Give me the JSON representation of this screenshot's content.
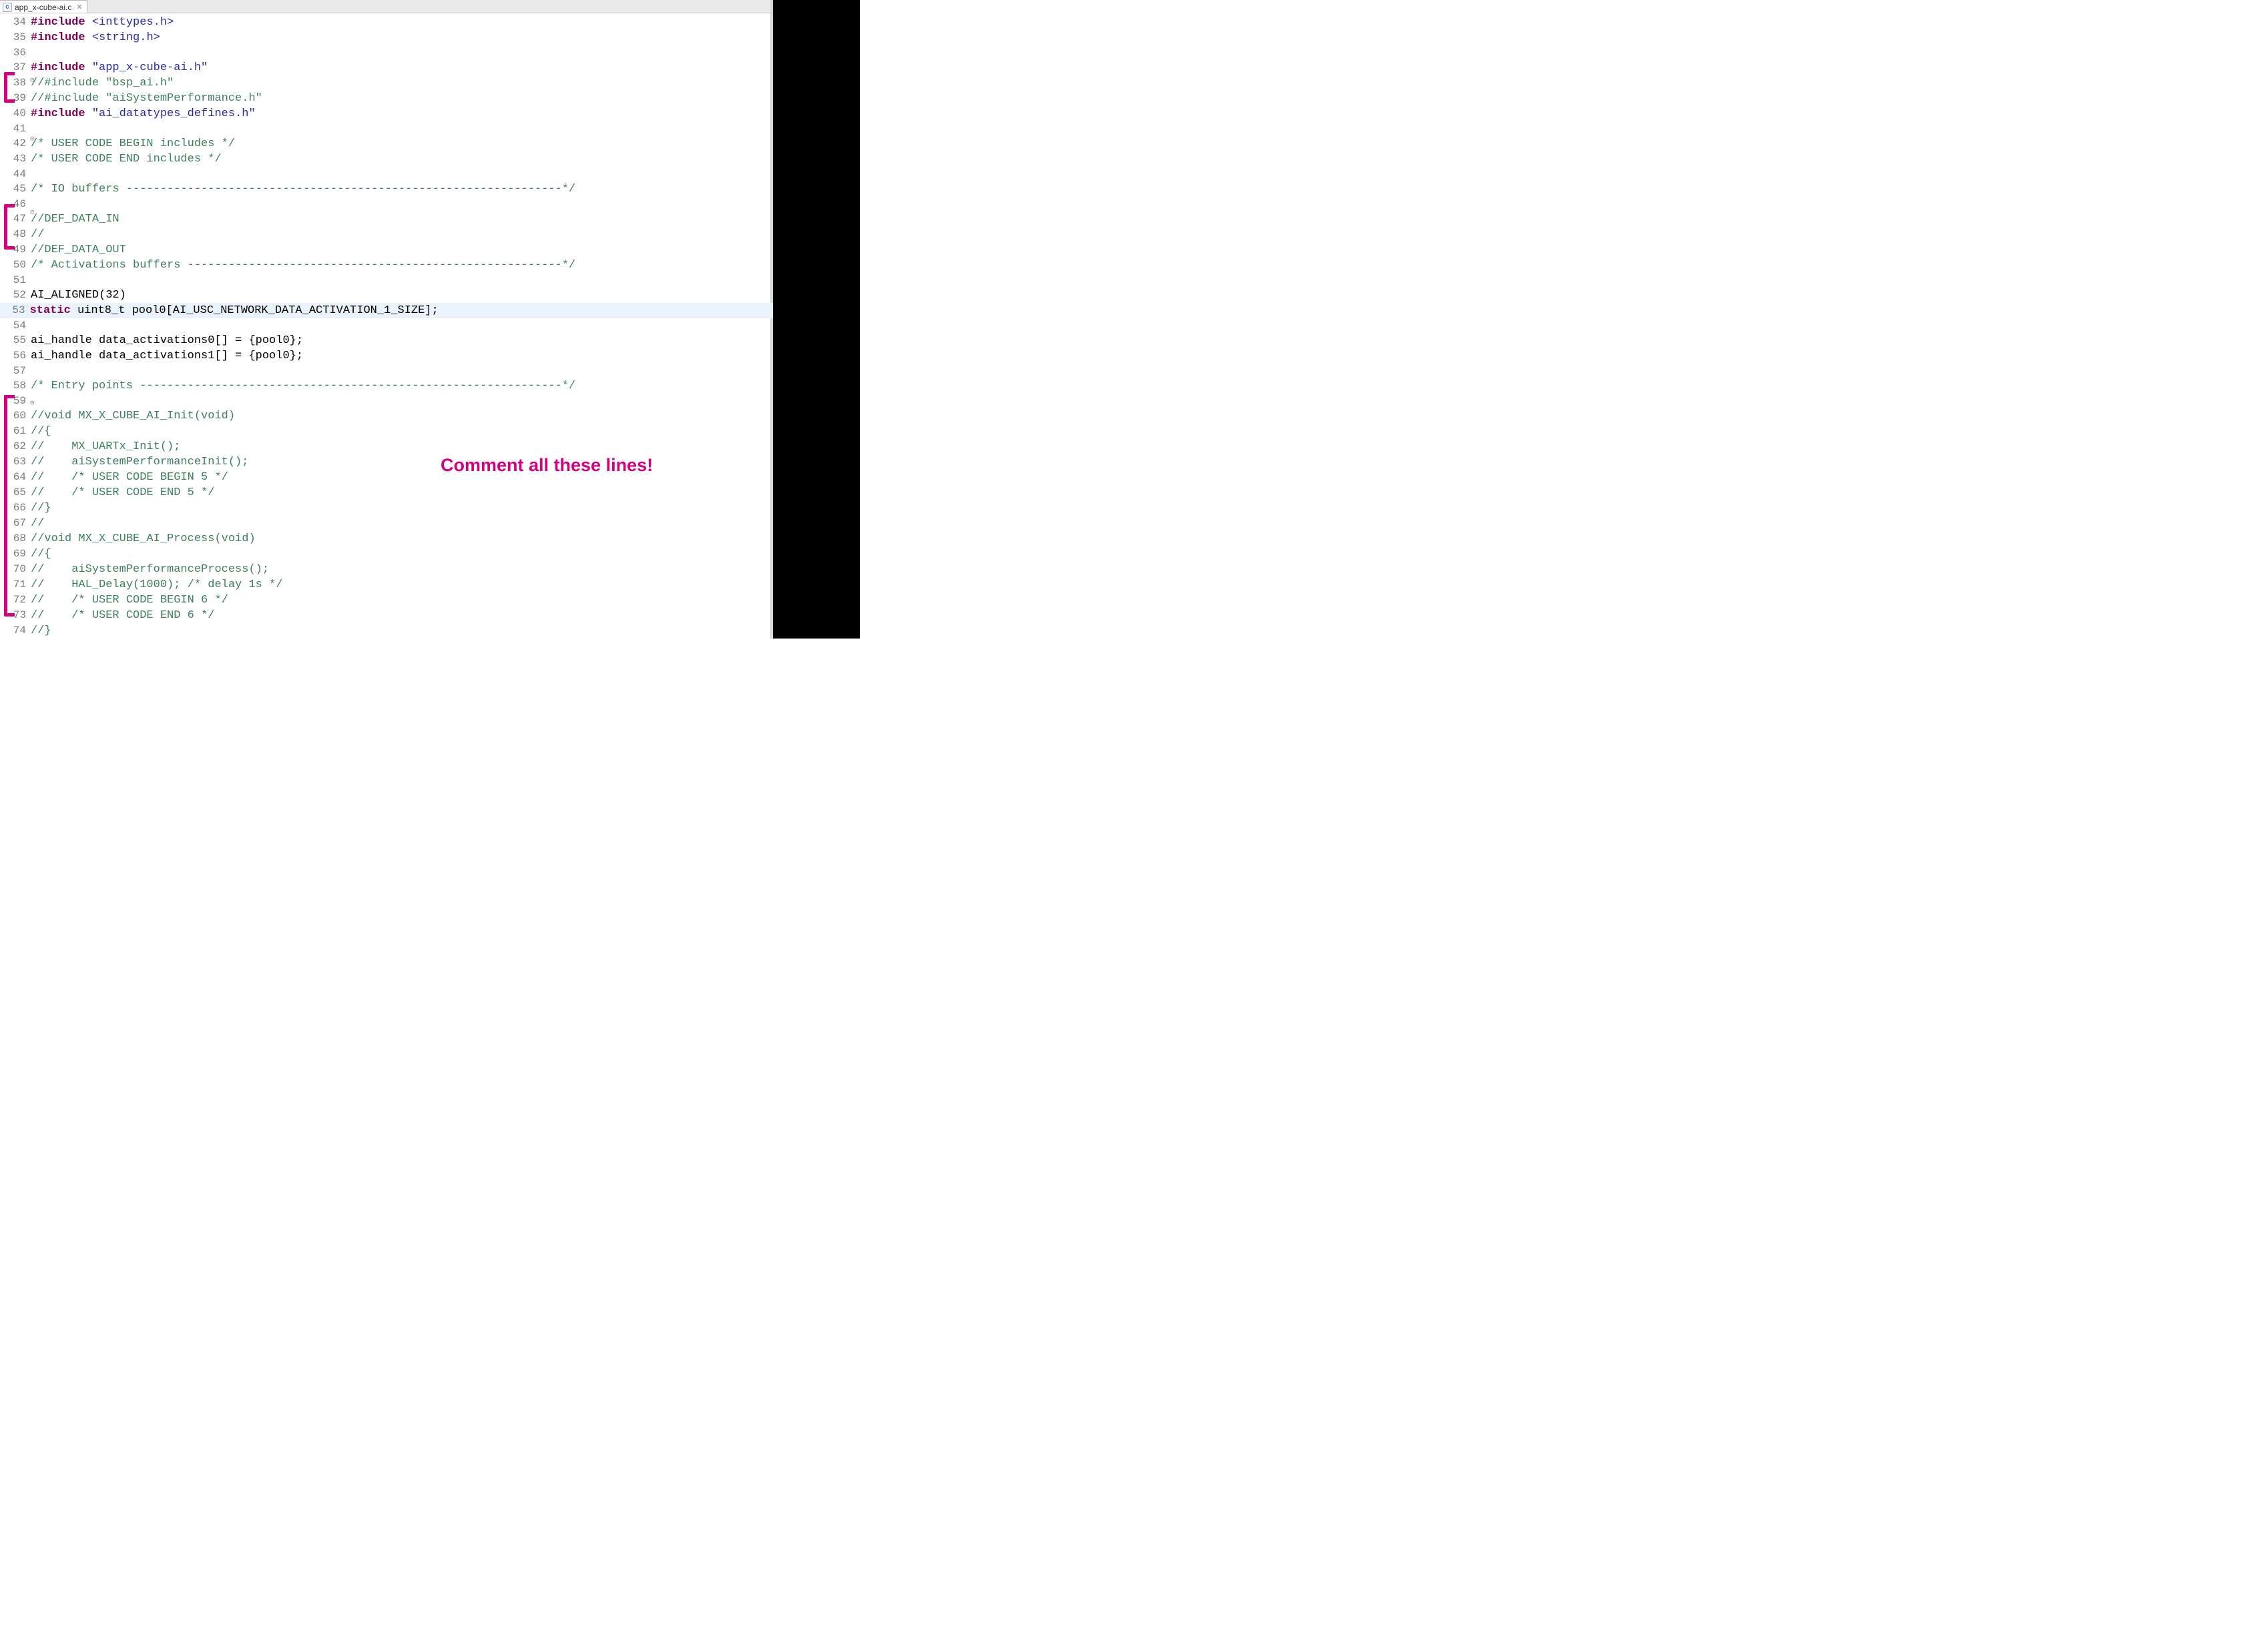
{
  "tab": {
    "icon_letter": "c",
    "filename": "app_x-cube-ai.c",
    "close_glyph": "✕"
  },
  "annotation": {
    "text": "Comment all these lines!"
  },
  "code_lines": [
    {
      "n": 34,
      "fold": "",
      "segs": [
        {
          "c": "pp",
          "t": "#include "
        },
        {
          "c": "inc",
          "t": "<inttypes.h>"
        }
      ]
    },
    {
      "n": 35,
      "fold": "",
      "segs": [
        {
          "c": "pp",
          "t": "#include "
        },
        {
          "c": "inc",
          "t": "<string.h>"
        }
      ]
    },
    {
      "n": 36,
      "fold": "",
      "segs": [
        {
          "c": "",
          "t": ""
        }
      ]
    },
    {
      "n": 37,
      "fold": "",
      "segs": [
        {
          "c": "pp",
          "t": "#include "
        },
        {
          "c": "str",
          "t": "\"app_x-cube-ai.h\""
        }
      ]
    },
    {
      "n": 38,
      "fold": "⊝",
      "segs": [
        {
          "c": "cmt",
          "t": "//#include \"bsp_ai.h\""
        }
      ]
    },
    {
      "n": 39,
      "fold": "",
      "segs": [
        {
          "c": "cmt",
          "t": "//#include \"aiSystemPerformance.h\""
        }
      ]
    },
    {
      "n": 40,
      "fold": "",
      "segs": [
        {
          "c": "pp",
          "t": "#include "
        },
        {
          "c": "str",
          "t": "\"ai_datatypes_defines.h\""
        }
      ]
    },
    {
      "n": 41,
      "fold": "",
      "segs": [
        {
          "c": "",
          "t": ""
        }
      ]
    },
    {
      "n": 42,
      "fold": "⊝",
      "segs": [
        {
          "c": "cmt",
          "t": "/* USER CODE BEGIN includes */"
        }
      ]
    },
    {
      "n": 43,
      "fold": "",
      "segs": [
        {
          "c": "cmt",
          "t": "/* USER CODE END includes */"
        }
      ]
    },
    {
      "n": 44,
      "fold": "",
      "segs": [
        {
          "c": "",
          "t": ""
        }
      ]
    },
    {
      "n": 45,
      "fold": "",
      "segs": [
        {
          "c": "cmt",
          "t": "/* IO buffers ----------------------------------------------------------------*/"
        }
      ]
    },
    {
      "n": 46,
      "fold": "",
      "segs": [
        {
          "c": "",
          "t": ""
        }
      ]
    },
    {
      "n": 47,
      "fold": "⊝",
      "segs": [
        {
          "c": "cmt",
          "t": "//DEF_DATA_IN"
        }
      ]
    },
    {
      "n": 48,
      "fold": "",
      "segs": [
        {
          "c": "cmt",
          "t": "//"
        }
      ]
    },
    {
      "n": 49,
      "fold": "",
      "segs": [
        {
          "c": "cmt",
          "t": "//DEF_DATA_OUT"
        }
      ]
    },
    {
      "n": 50,
      "fold": "",
      "segs": [
        {
          "c": "cmt",
          "t": "/* Activations buffers -------------------------------------------------------*/"
        }
      ]
    },
    {
      "n": 51,
      "fold": "",
      "segs": [
        {
          "c": "",
          "t": ""
        }
      ]
    },
    {
      "n": 52,
      "fold": "",
      "segs": [
        {
          "c": "",
          "t": "AI_ALIGNED(32)"
        }
      ]
    },
    {
      "n": 53,
      "fold": "",
      "cur": true,
      "segs": [
        {
          "c": "kw",
          "t": "static"
        },
        {
          "c": "",
          "t": " uint8_t pool0[AI_USC_NETWORK_DATA_ACTIVATION_1_SIZE];"
        }
      ]
    },
    {
      "n": 54,
      "fold": "",
      "segs": [
        {
          "c": "",
          "t": ""
        }
      ]
    },
    {
      "n": 55,
      "fold": "",
      "segs": [
        {
          "c": "",
          "t": "ai_handle data_activations0[] = {pool0};"
        }
      ]
    },
    {
      "n": 56,
      "fold": "",
      "segs": [
        {
          "c": "",
          "t": "ai_handle data_activations1[] = {pool0};"
        }
      ]
    },
    {
      "n": 57,
      "fold": "",
      "segs": [
        {
          "c": "",
          "t": ""
        }
      ]
    },
    {
      "n": 58,
      "fold": "",
      "segs": [
        {
          "c": "cmt",
          "t": "/* Entry points --------------------------------------------------------------*/"
        }
      ]
    },
    {
      "n": 59,
      "fold": "",
      "segs": [
        {
          "c": "",
          "t": ""
        }
      ]
    },
    {
      "n": 60,
      "fold": "⊝",
      "segs": [
        {
          "c": "cmt",
          "t": "//void MX_X_CUBE_AI_Init(void)"
        }
      ]
    },
    {
      "n": 61,
      "fold": "",
      "segs": [
        {
          "c": "cmt",
          "t": "//{"
        }
      ]
    },
    {
      "n": 62,
      "fold": "",
      "segs": [
        {
          "c": "cmt",
          "t": "//    MX_UARTx_Init();"
        }
      ]
    },
    {
      "n": 63,
      "fold": "",
      "segs": [
        {
          "c": "cmt",
          "t": "//    aiSystemPerformanceInit();"
        }
      ]
    },
    {
      "n": 64,
      "fold": "",
      "segs": [
        {
          "c": "cmt",
          "t": "//    /* USER CODE BEGIN 5 */"
        }
      ]
    },
    {
      "n": 65,
      "fold": "",
      "segs": [
        {
          "c": "cmt",
          "t": "//    /* USER CODE END 5 */"
        }
      ]
    },
    {
      "n": 66,
      "fold": "",
      "segs": [
        {
          "c": "cmt",
          "t": "//}"
        }
      ]
    },
    {
      "n": 67,
      "fold": "",
      "segs": [
        {
          "c": "cmt",
          "t": "//"
        }
      ]
    },
    {
      "n": 68,
      "fold": "",
      "segs": [
        {
          "c": "cmt",
          "t": "//void MX_X_CUBE_AI_Process(void)"
        }
      ]
    },
    {
      "n": 69,
      "fold": "",
      "segs": [
        {
          "c": "cmt",
          "t": "//{"
        }
      ]
    },
    {
      "n": 70,
      "fold": "",
      "segs": [
        {
          "c": "cmt",
          "t": "//    aiSystemPerformanceProcess();"
        }
      ]
    },
    {
      "n": 71,
      "fold": "",
      "segs": [
        {
          "c": "cmt",
          "t": "//    HAL_Delay(1000); /* delay 1s */"
        }
      ]
    },
    {
      "n": 72,
      "fold": "",
      "segs": [
        {
          "c": "cmt",
          "t": "//    /* USER CODE BEGIN 6 */"
        }
      ]
    },
    {
      "n": 73,
      "fold": "",
      "segs": [
        {
          "c": "cmt",
          "t": "//    /* USER CODE END 6 */"
        }
      ]
    },
    {
      "n": 74,
      "fold": "",
      "segs": [
        {
          "c": "cmt",
          "t": "//}"
        }
      ]
    }
  ],
  "brackets": [
    {
      "top_line": 38,
      "bottom_line": 39
    },
    {
      "top_line": 47,
      "bottom_line": 49
    },
    {
      "top_line": 60,
      "bottom_line": 74
    }
  ]
}
